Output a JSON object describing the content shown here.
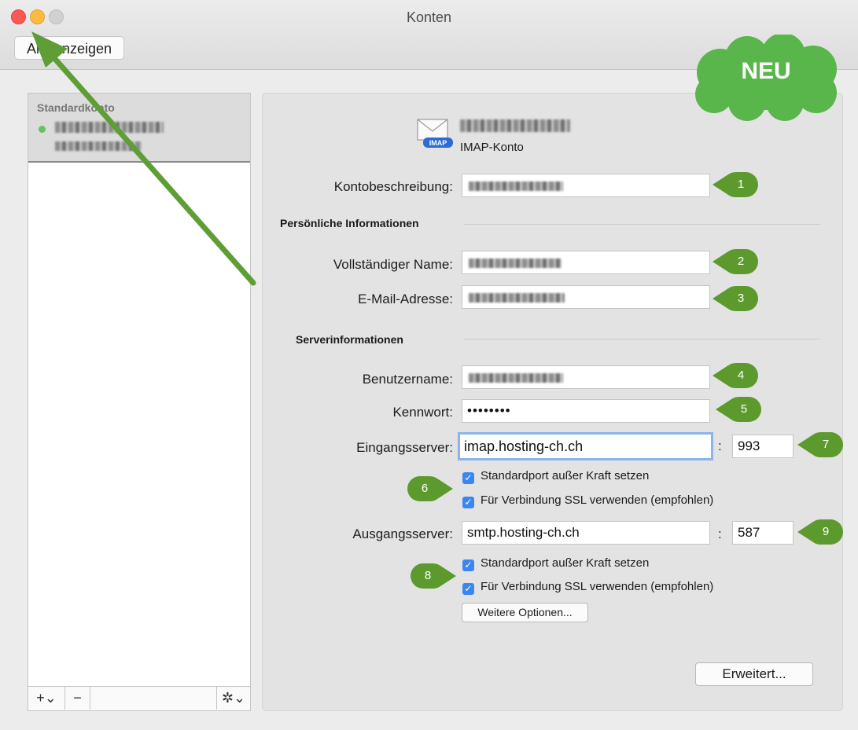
{
  "window": {
    "title": "Konten",
    "show_all_label": "Alle anzeigen"
  },
  "sidebar": {
    "section_header": "Standardkonto",
    "add_button": "+⌄",
    "remove_button": "−",
    "gear_button": "✲⌄"
  },
  "account": {
    "type_label": "IMAP-Konto",
    "icon_badge": "IMAP"
  },
  "form": {
    "kontobeschreibung_label": "Kontobeschreibung:",
    "personal_section": "Persönliche Informationen",
    "name_label": "Vollständiger Name:",
    "email_label": "E-Mail-Adresse:",
    "server_section": "Serverinformationen",
    "username_label": "Benutzername:",
    "password_label": "Kennwort:",
    "password_value": "••••••••",
    "incoming_label": "Eingangsserver:",
    "incoming_value": "imap.hosting-ch.ch",
    "incoming_port": "993",
    "outgoing_label": "Ausgangsserver:",
    "outgoing_value": "smtp.hosting-ch.ch",
    "outgoing_port": "587",
    "colon": ":",
    "override_port_label": "Standardport außer Kraft setzen",
    "use_ssl_label": "Für Verbindung SSL verwenden (empfohlen)",
    "more_options_button": "Weitere Optionen...",
    "advanced_button": "Erweitert..."
  },
  "annotations": {
    "new_badge": "NEU",
    "markers": [
      "1",
      "2",
      "3",
      "4",
      "5",
      "6",
      "7",
      "8",
      "9"
    ],
    "marker_color": "#5d9a2e",
    "arrow_color": "#5f9e36"
  }
}
